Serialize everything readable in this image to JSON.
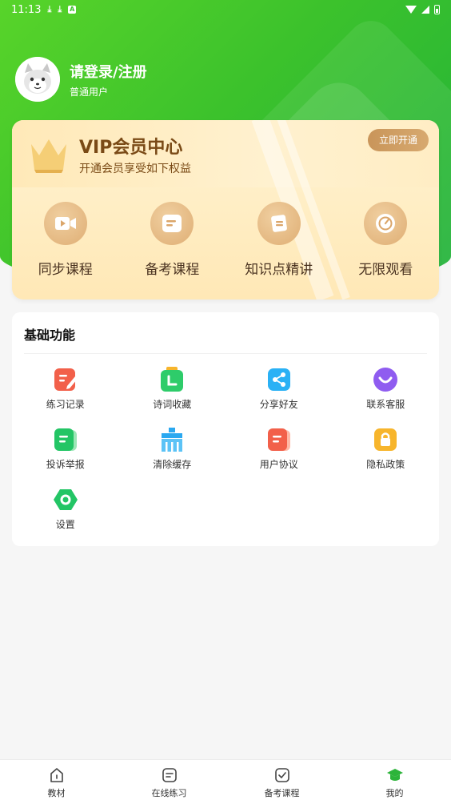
{
  "status_bar": {
    "time": "11:13",
    "notif_download_1": "⤓",
    "notif_download_2": "⤓",
    "notif_app": "A"
  },
  "profile": {
    "login_label": "请登录/注册",
    "user_type": "普通用户"
  },
  "vip": {
    "title": "VIP会员中心",
    "subtitle": "开通会员享受如下权益",
    "open_button": "立即开通",
    "benefits": [
      {
        "label": "同步课程",
        "icon": "video-icon"
      },
      {
        "label": "备考课程",
        "icon": "document-icon"
      },
      {
        "label": "知识点精讲",
        "icon": "book-icon"
      },
      {
        "label": "无限观看",
        "icon": "gauge-icon"
      }
    ]
  },
  "basic": {
    "title": "基础功能",
    "items": [
      {
        "label": "练习记录",
        "icon": "edit-record-icon"
      },
      {
        "label": "诗词收藏",
        "icon": "clock-bookmark-icon"
      },
      {
        "label": "分享好友",
        "icon": "share-icon"
      },
      {
        "label": "联系客服",
        "icon": "service-icon"
      },
      {
        "label": "投诉举报",
        "icon": "complaint-icon"
      },
      {
        "label": "清除缓存",
        "icon": "clear-cache-icon"
      },
      {
        "label": "用户协议",
        "icon": "agreement-icon"
      },
      {
        "label": "隐私政策",
        "icon": "lock-icon"
      },
      {
        "label": "设置",
        "icon": "settings-icon"
      }
    ]
  },
  "nav": {
    "items": [
      {
        "label": "教材",
        "icon": "home-icon",
        "active": false
      },
      {
        "label": "在线练习",
        "icon": "practice-icon",
        "active": false
      },
      {
        "label": "备考课程",
        "icon": "exam-course-icon",
        "active": false
      },
      {
        "label": "我的",
        "icon": "graduation-cap-icon",
        "active": true
      }
    ]
  },
  "colors": {
    "brand_green": "#3cc22c",
    "vip_brown": "#7a4a16",
    "vip_gold": "#d7a96f",
    "nav_active": "#2db43a"
  }
}
